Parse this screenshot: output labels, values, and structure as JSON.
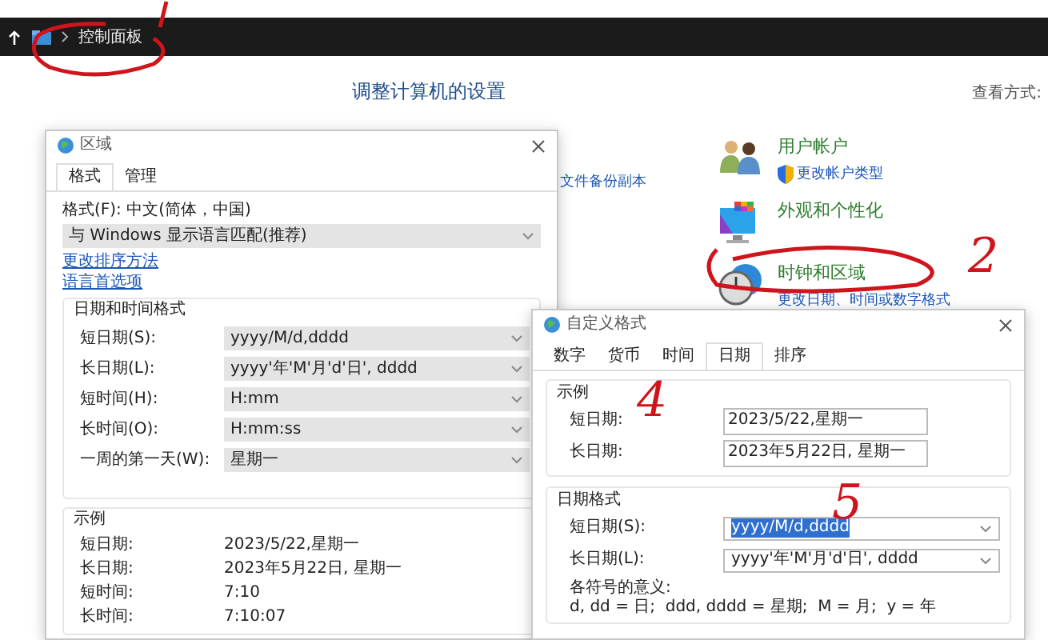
{
  "address_bar": {
    "breadcrumb": "控制面板"
  },
  "header": {
    "title": "调整计算机的设置",
    "view_by_label": "查看方式:"
  },
  "background_fragment": "文件备份副本",
  "categories": [
    {
      "kind": "users",
      "title": "用户帐户",
      "link": "更改帐户类型"
    },
    {
      "kind": "appearance",
      "title": "外观和个性化"
    },
    {
      "kind": "clock",
      "title": "时钟和区域",
      "link": "更改日期、时间或数字格式"
    }
  ],
  "region_dialog": {
    "title": "区域",
    "tabs": [
      {
        "label": "格式",
        "selected": true
      },
      {
        "label": "管理",
        "selected": false
      }
    ],
    "format_label": "格式(F): 中文(简体，中国)",
    "format_value": "与 Windows 显示语言匹配(推荐)",
    "links": [
      "更改排序方法",
      "语言首选项"
    ],
    "formats_group": {
      "title": "日期和时间格式",
      "rows": [
        {
          "label": "短日期(S):",
          "value": "yyyy/M/d,dddd"
        },
        {
          "label": "长日期(L):",
          "value": "yyyy'年'M'月'd'日', dddd"
        },
        {
          "label": "短时间(H):",
          "value": "H:mm"
        },
        {
          "label": "长时间(O):",
          "value": "H:mm:ss"
        },
        {
          "label": "一周的第一天(W):",
          "value": "星期一"
        }
      ]
    },
    "example_group": {
      "title": "示例",
      "rows": [
        {
          "label": "短日期:",
          "value": "2023/5/22,星期一"
        },
        {
          "label": "长日期:",
          "value": "2023年5月22日, 星期一"
        },
        {
          "label": "短时间:",
          "value": "7:10"
        },
        {
          "label": "长时间:",
          "value": "7:10:07"
        }
      ]
    }
  },
  "custom_dialog": {
    "title": "自定义格式",
    "tabs": [
      {
        "label": "数字",
        "selected": false
      },
      {
        "label": "货币",
        "selected": false
      },
      {
        "label": "时间",
        "selected": false
      },
      {
        "label": "日期",
        "selected": true
      },
      {
        "label": "排序",
        "selected": false
      }
    ],
    "example_group": {
      "title": "示例",
      "rows": [
        {
          "label": "短日期:",
          "value": "2023/5/22,星期一"
        },
        {
          "label": "长日期:",
          "value": "2023年5月22日, 星期一"
        }
      ]
    },
    "format_group": {
      "title": "日期格式",
      "rows": [
        {
          "label": "短日期(S):",
          "value": "yyyy/M/d,dddd",
          "selected": true
        },
        {
          "label": "长日期(L):",
          "value": "yyyy'年'M'月'd'日', dddd",
          "selected": false
        }
      ],
      "legend_title": "各符号的意义:",
      "legend": "d, dd = 日;  ddd, dddd = 星期;  M = 月;  y = 年"
    }
  },
  "annotations": [
    {
      "kind": "stroke"
    },
    {
      "kind": "ellipse"
    },
    {
      "kind": "ellipse"
    },
    {
      "kind": "number",
      "text": "2"
    },
    {
      "kind": "number",
      "text": "4"
    },
    {
      "kind": "number",
      "text": "5"
    }
  ]
}
